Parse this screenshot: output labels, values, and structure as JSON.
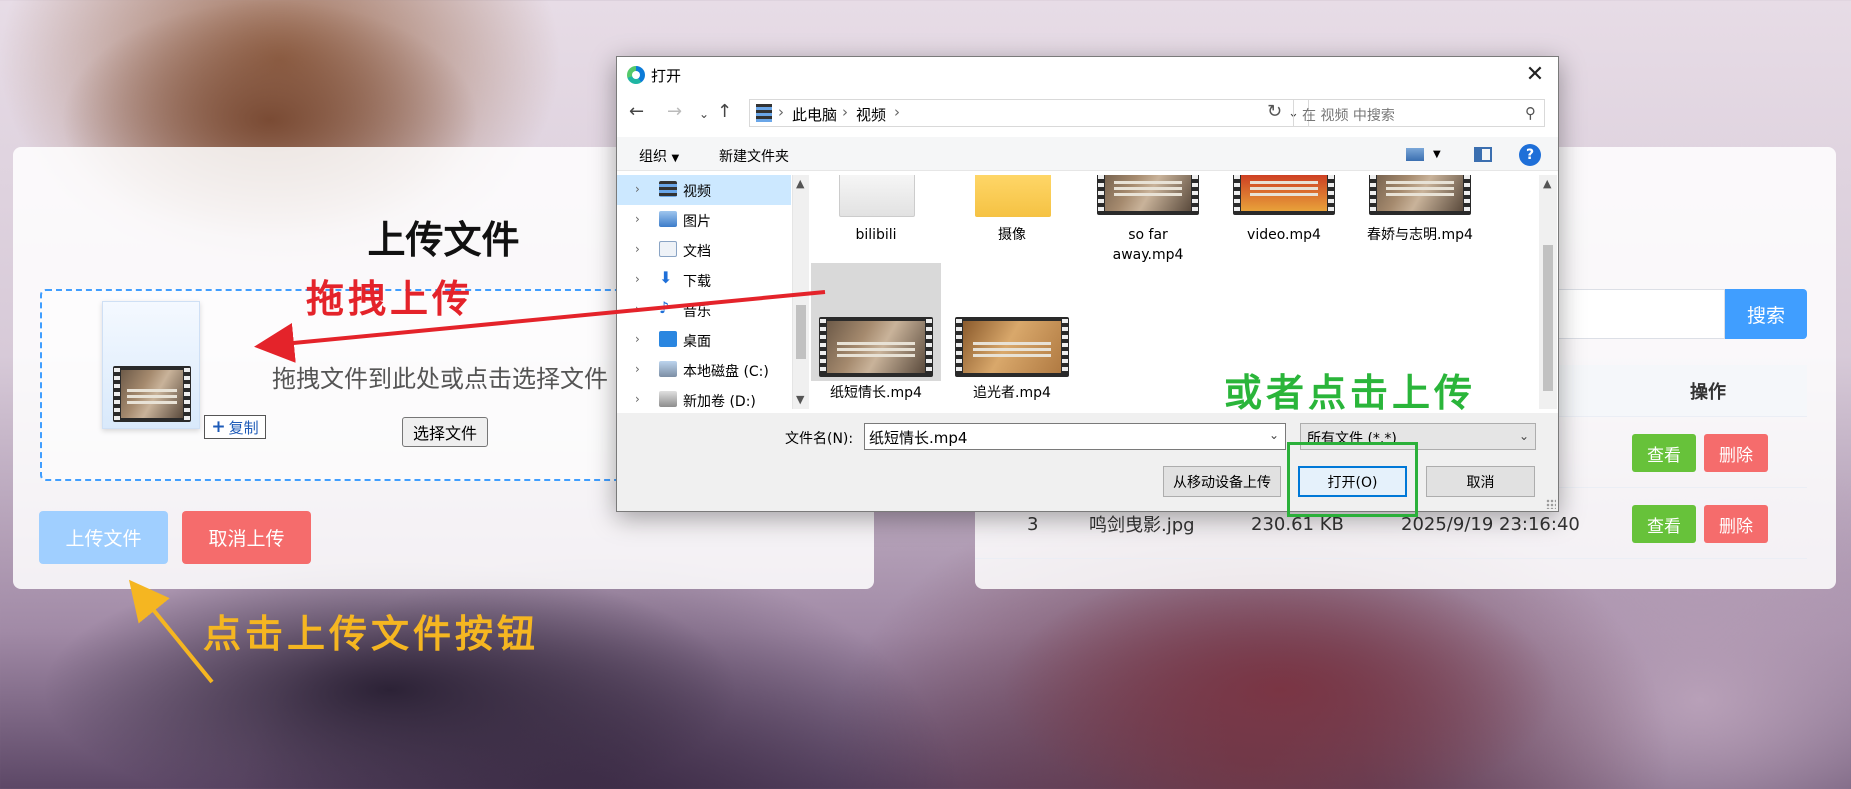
{
  "upload_panel": {
    "title": "上传文件",
    "drop_text": "拖拽文件到此处或点击选择文件",
    "choose_button": "选择文件",
    "copy_badge": "复制",
    "upload_button": "上传文件",
    "cancel_button": "取消上传"
  },
  "file_list": {
    "search_button": "搜索",
    "ops_header": "操作",
    "rows": [
      {
        "view": "查看",
        "delete": "删除"
      },
      {
        "index": "3",
        "name": "鸣剑曳影.jpg",
        "size": "230.61 KB",
        "time": "2025/9/19 23:16:40",
        "view": "查看",
        "delete": "删除"
      }
    ]
  },
  "dialog": {
    "title": "打开",
    "breadcrumb": [
      "此电脑",
      "视频"
    ],
    "search_placeholder": "在 视频 中搜索",
    "toolbar": {
      "organize": "组织",
      "new_folder": "新建文件夹",
      "help": "?"
    },
    "sidebar": [
      "视频",
      "图片",
      "文档",
      "下载",
      "音乐",
      "桌面",
      "本地磁盘 (C:)",
      "新加卷 (D:)"
    ],
    "files": [
      {
        "name": "bilibili",
        "kind": "folder"
      },
      {
        "name": "摄像",
        "kind": "folder"
      },
      {
        "name": "so far away.mp4",
        "line1": "so far",
        "line2": "away.mp4",
        "kind": "video"
      },
      {
        "name": "video.mp4",
        "kind": "video"
      },
      {
        "name": "春娇与志明.mp4",
        "kind": "video"
      },
      {
        "name": "纸短情长.mp4",
        "kind": "video",
        "selected": true
      },
      {
        "name": "追光者.mp4",
        "kind": "video"
      }
    ],
    "filename_label": "文件名(N):",
    "filename_value": "纸短情长.mp4",
    "filetype_value": "所有文件 (*.*)",
    "from_device_button": "从移动设备上传",
    "open_button": "打开(O)",
    "cancel_button": "取消"
  },
  "annotations": {
    "drag_upload": "拖拽上传",
    "or_click_upload": "或者点击上传",
    "click_upload_button": "点击上传文件按钮"
  },
  "colors": {
    "primary": "#409eff",
    "primary_light": "#a0cfff",
    "danger": "#f56c6c",
    "success": "#67c23a",
    "annotation_red": "#e4232a",
    "annotation_green": "#2ab53a",
    "annotation_yellow": "#f5b621"
  }
}
